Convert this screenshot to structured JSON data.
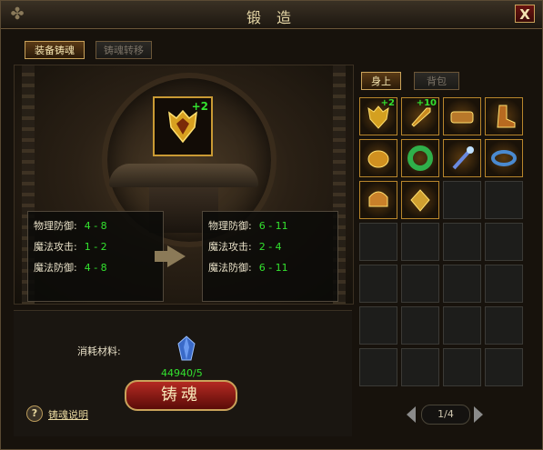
{
  "window": {
    "title": "锻 造",
    "close_label": "X"
  },
  "tabs": {
    "left": [
      "装备铸魂",
      "铸魂转移"
    ],
    "right": [
      "身上",
      "背包"
    ]
  },
  "forge": {
    "main_slot": {
      "icon": "armor-icon",
      "plus": "+2"
    },
    "current_stats": [
      {
        "label": "物理防御:",
        "value": "4 - 8"
      },
      {
        "label": "魔法攻击:",
        "value": "1 - 2"
      },
      {
        "label": "魔法防御:",
        "value": "4 - 8"
      }
    ],
    "next_stats": [
      {
        "label": "物理防御:",
        "value": "6 - 11"
      },
      {
        "label": "魔法攻击:",
        "value": "2 - 4"
      },
      {
        "label": "魔法防御:",
        "value": "6 - 11"
      }
    ],
    "material_label": "消耗材料:",
    "material_icon": "crystal-icon",
    "material_count": "44940/5",
    "forge_button": "铸魂",
    "help_icon": "?",
    "help_link": "铸魂说明"
  },
  "inventory": {
    "items": [
      {
        "icon": "armor-icon",
        "plus": "+2",
        "color": "#d4a020"
      },
      {
        "icon": "sword-icon",
        "plus": "+10",
        "color": "#c98a20"
      },
      {
        "icon": "belt-icon",
        "plus": "",
        "color": "#b8782a"
      },
      {
        "icon": "boots-icon",
        "plus": "",
        "color": "#b86a20"
      },
      {
        "icon": "bracer-icon",
        "plus": "",
        "color": "#d09020"
      },
      {
        "icon": "jade-ring-icon",
        "plus": "",
        "color": "#2fb04a"
      },
      {
        "icon": "staff-icon",
        "plus": "",
        "color": "#6a8adf"
      },
      {
        "icon": "bracelet-icon",
        "plus": "",
        "color": "#4a8ad0"
      },
      {
        "icon": "helmet-icon",
        "plus": "",
        "color": "#c9802a"
      },
      {
        "icon": "amulet-icon",
        "plus": "",
        "color": "#d0a030"
      }
    ],
    "page": "1/4"
  }
}
